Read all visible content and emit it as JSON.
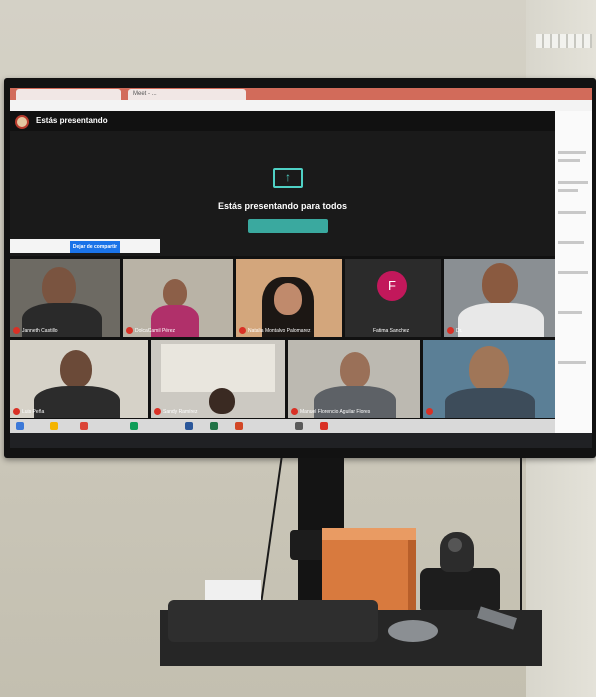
{
  "scene": {
    "colors": {
      "wall": "#cfcbbe",
      "meet_bg": "#111111",
      "accent_teal": "#4fd1c5",
      "share_blue": "#1a73e8",
      "mic_red": "#d93025",
      "avatar_magenta": "#c2185b",
      "tab_red": "#d26b5a",
      "box_orange": "#d87a3e"
    }
  },
  "browser": {
    "tabs": [
      "",
      "Meet - ..."
    ]
  },
  "meet": {
    "header_title": "Estás presentando",
    "present_message": "Estás presentando para todos",
    "stop_share_label": "Dejar de compartir",
    "stop_presenting_label": "",
    "icon": "present-screen-icon"
  },
  "participants": [
    {
      "name": "Janneth Castillo"
    },
    {
      "name": "DolcaCamil Pérez"
    },
    {
      "name": "Natalia Montalvo Palomarez"
    },
    {
      "name": "Fatima Sanchez",
      "avatar_letter": "F"
    },
    {
      "name": "Dr."
    },
    {
      "name": "Luis Peña"
    },
    {
      "name": "Sandy Ramírez"
    },
    {
      "name": "Manuel Florencio Aguilar Flores"
    },
    {
      "name": ""
    }
  ],
  "side_panel": {
    "title": ""
  },
  "monitor": {
    "brand": ""
  }
}
